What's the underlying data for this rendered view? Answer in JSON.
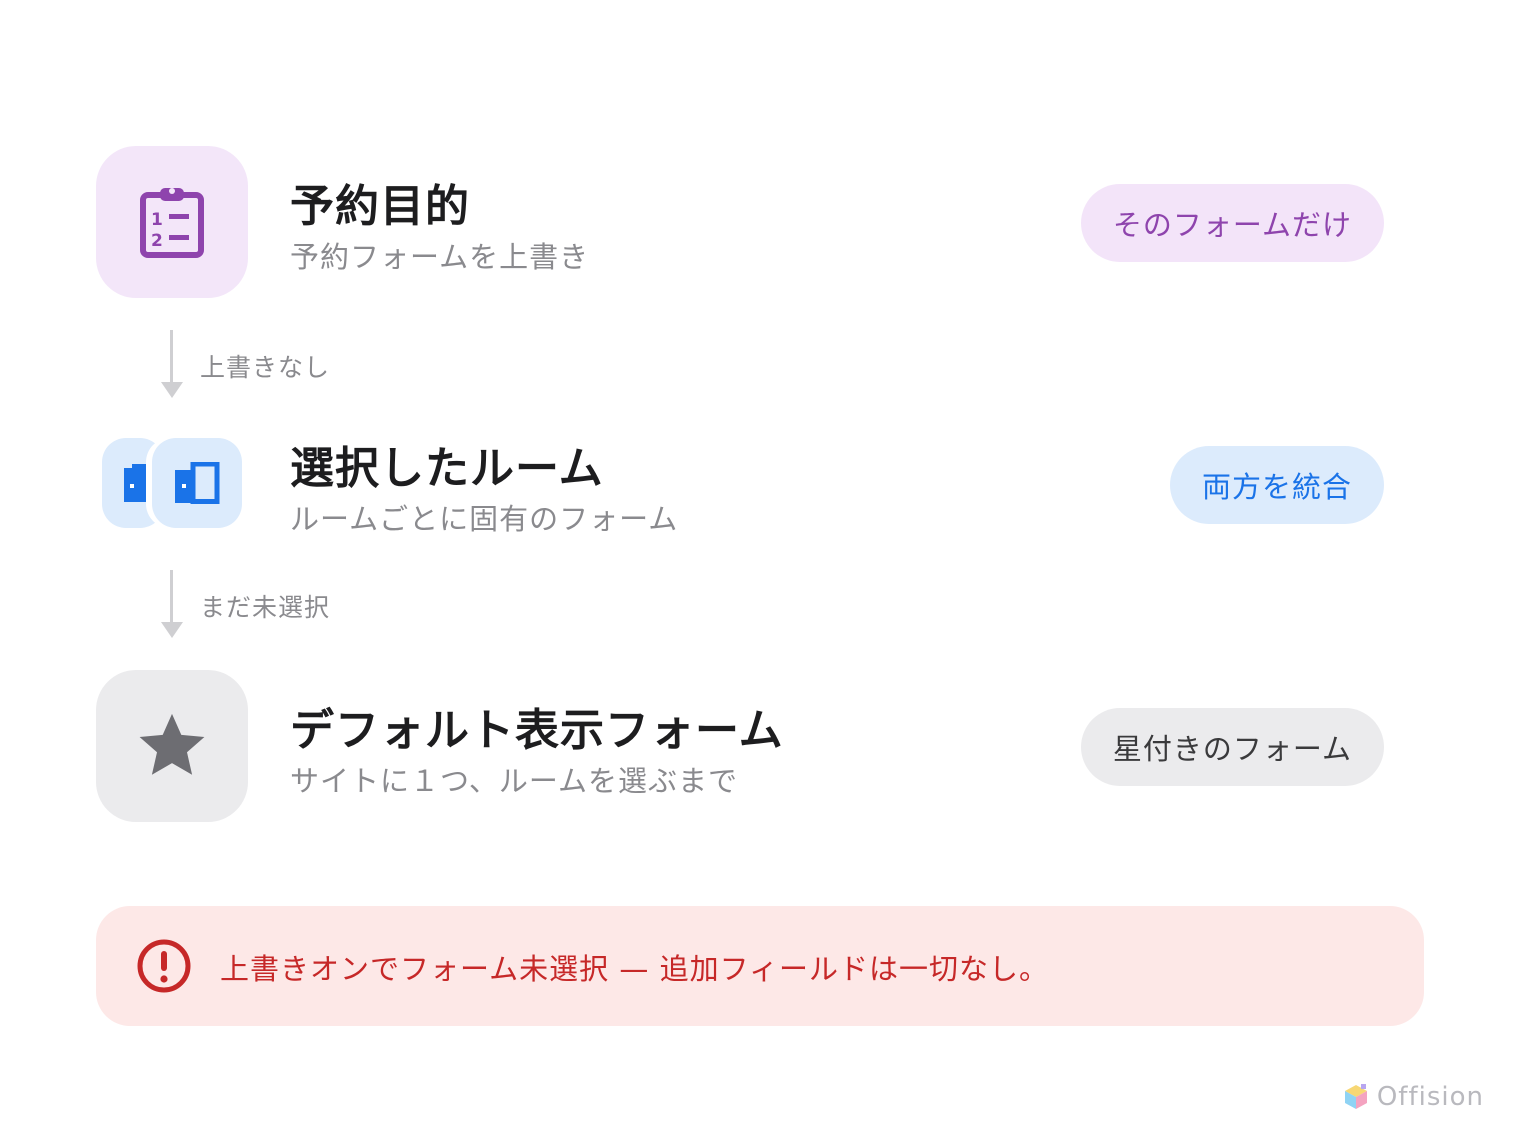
{
  "steps": [
    {
      "title": "予約目的",
      "subtitle": "予約フォームを上書き",
      "pill": "そのフォームだけ",
      "icon": "clipboard-list-icon",
      "accent": "#8e44ad",
      "tile_bg": "#f3e6f9"
    },
    {
      "title": "選択したルーム",
      "subtitle": "ルームごとに固有のフォーム",
      "pill": "両方を統合",
      "icon": "door-icon",
      "accent": "#1a73e8",
      "tile_bg": "#dcebfc"
    },
    {
      "title": "デフォルト表示フォーム",
      "subtitle": "サイトに１つ、ルームを選ぶまで",
      "pill": "星付きのフォーム",
      "icon": "star-icon",
      "accent": "#6d6d72",
      "tile_bg": "#ebebed"
    }
  ],
  "connectors": [
    {
      "label": "上書きなし"
    },
    {
      "label": "まだ未選択"
    }
  ],
  "alert": {
    "text": "上書きオンでフォーム未選択 — 追加フィールドは一切なし。",
    "icon": "exclamation-circle-icon",
    "color": "#c62828",
    "bg": "#fde8e7"
  },
  "brand": {
    "name": "Offision",
    "icon": "offision-logo-icon"
  }
}
